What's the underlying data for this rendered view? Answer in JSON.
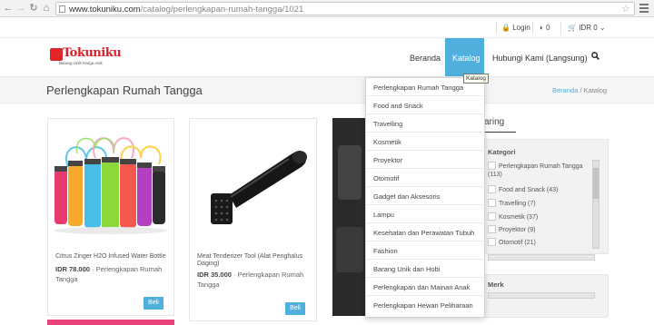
{
  "browser": {
    "url_domain": "www.tokuniku.com",
    "url_path": "/catalog/perlengkapan-rumah-tangga/1021"
  },
  "top_bar": {
    "login": "Login",
    "compare_count": "0",
    "cart": "IDR 0"
  },
  "brand": {
    "name": "Tokuniku",
    "tagline": "Barang Unik Harga Asik",
    "color": "#d8202a"
  },
  "menu": {
    "home": "Beranda",
    "catalog": "Katalog",
    "contact": "Hubungi Kami (Langsung)",
    "accent": "#4fb0de"
  },
  "page": {
    "title": "Perlengkapan Rumah Tangga",
    "crumb_home": "Beranda",
    "crumb_sep": "/",
    "crumb_current": "Katalog"
  },
  "products": [
    {
      "name": "Citrus Zinger H2O Infused Water Bottle",
      "price": "IDR 78.000",
      "category": "Perlengkapan Rumah Tangga",
      "buy": "Beli"
    },
    {
      "name": "Meat Tenderizer Tool (Alat Penghalus Daging)",
      "price": "IDR 35.000",
      "category": "Perlengkapan Rumah Tangga",
      "buy": "Beli"
    }
  ],
  "sidebar": {
    "filter_heading": "aring",
    "category_label": "Kategori",
    "brand_label": "Merk",
    "categories": [
      {
        "label": "Perlengkapan Rumah Tangga",
        "count": "(113)"
      },
      {
        "label": "Food and Snack (43)"
      },
      {
        "label": "Travelling (7)"
      },
      {
        "label": "Kosmetik (37)"
      },
      {
        "label": "Proyektor (9)"
      },
      {
        "label": "Otomotif (21)"
      }
    ]
  },
  "dropdown": {
    "tooltip": "Katalog",
    "items": [
      "Perlengkapan Rumah Tangga",
      "Food and Snack",
      "Travelling",
      "Kosmetik",
      "Proyektor",
      "Otomotif",
      "Gadget dan Aksesoris",
      "Lampu",
      "Kesehatan dan Perawatan Tubuh",
      "Fashion",
      "Barang Unik dan Hobi",
      "Perlengkapan dan Mainan Anak",
      "Perlengkapan Hewan Peliharaan"
    ]
  }
}
